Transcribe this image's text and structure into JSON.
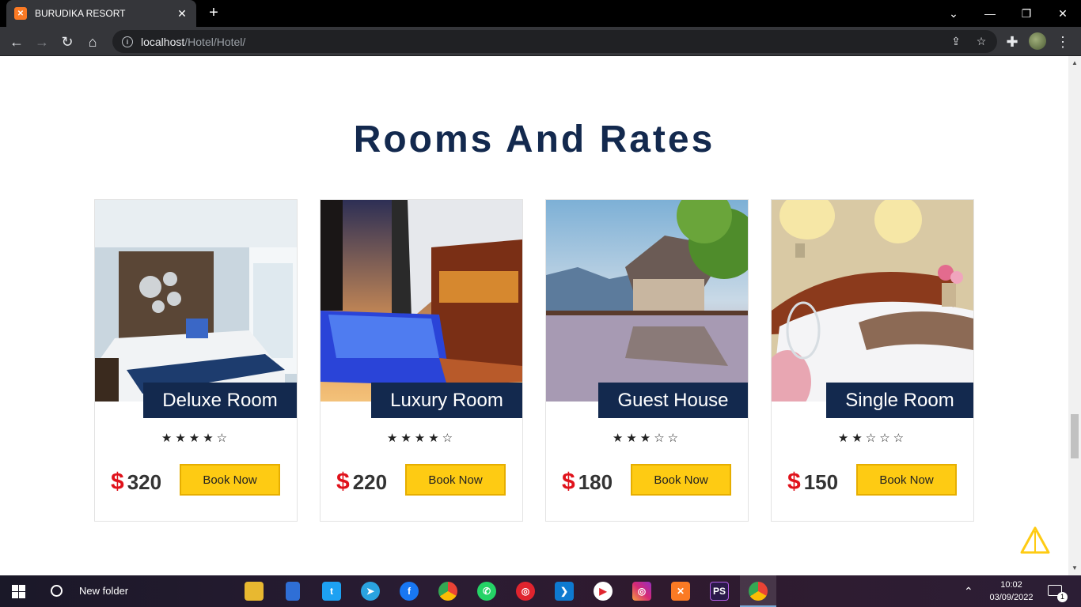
{
  "browser": {
    "tab_title": "BURUDIKA RESORT",
    "tab_favicon": "xampp-icon",
    "url_host": "localhost",
    "url_path": "/Hotel/Hotel/"
  },
  "section": {
    "title": "Rooms And Rates"
  },
  "rooms": [
    {
      "name": "Deluxe Room",
      "rating": 4,
      "stars": "★★★★☆",
      "currency": "$",
      "price": "320",
      "book_label": "Book Now"
    },
    {
      "name": "Luxury Room",
      "rating": 4,
      "stars": "★★★★☆",
      "currency": "$",
      "price": "220",
      "book_label": "Book Now"
    },
    {
      "name": "Guest House",
      "rating": 3,
      "stars": "★★★☆☆",
      "currency": "$",
      "price": "180",
      "book_label": "Book Now"
    },
    {
      "name": "Single Room",
      "rating": 2,
      "stars": "★★☆☆☆",
      "currency": "$",
      "price": "150",
      "book_label": "Book Now"
    }
  ],
  "taskbar": {
    "search_label": "New folder",
    "time": "10:02",
    "date": "03/09/2022",
    "notification_count": "1"
  },
  "colors": {
    "accent_navy": "#13294e",
    "button_yellow": "#fecb13",
    "price_red": "#e0121b"
  }
}
